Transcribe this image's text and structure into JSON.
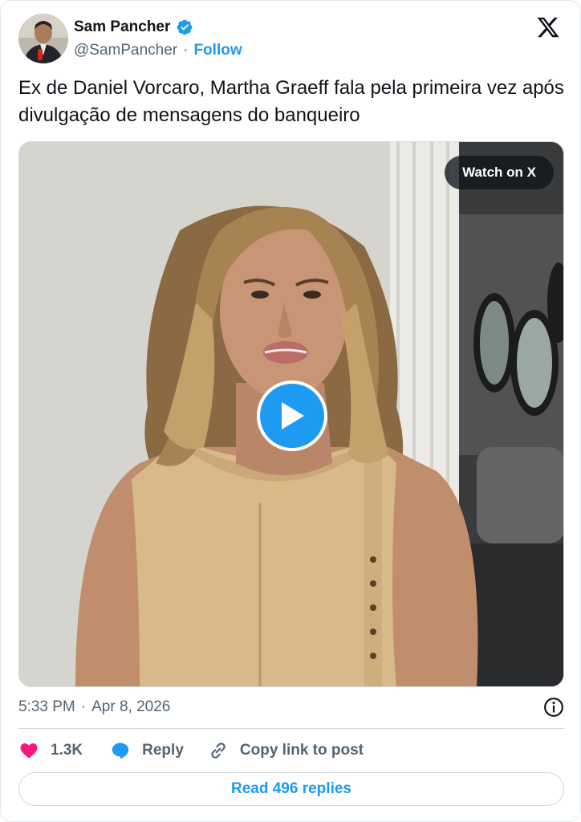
{
  "author": {
    "name": "Sam Pancher",
    "handle": "@SamPancher",
    "separator": "·",
    "follow_label": "Follow",
    "verified_color": "#1d9bf0"
  },
  "tweet": {
    "text": "Ex de Daniel Vorcaro, Martha Graeff fala pela primeira vez após divulgação de mensagens do banqueiro"
  },
  "media": {
    "watch_label": "Watch on X",
    "play_icon": "play-icon"
  },
  "meta": {
    "time": "5:33 PM",
    "separator": "·",
    "date": "Apr 8, 2026",
    "info_icon": "info-icon"
  },
  "actions": {
    "like_count": "1.3K",
    "reply_label": "Reply",
    "copy_label": "Copy link to post"
  },
  "footer": {
    "read_replies_label": "Read 496 replies"
  },
  "colors": {
    "accent": "#1d9bf0",
    "like": "#f91880",
    "text": "#0f1419",
    "muted": "#536471"
  }
}
